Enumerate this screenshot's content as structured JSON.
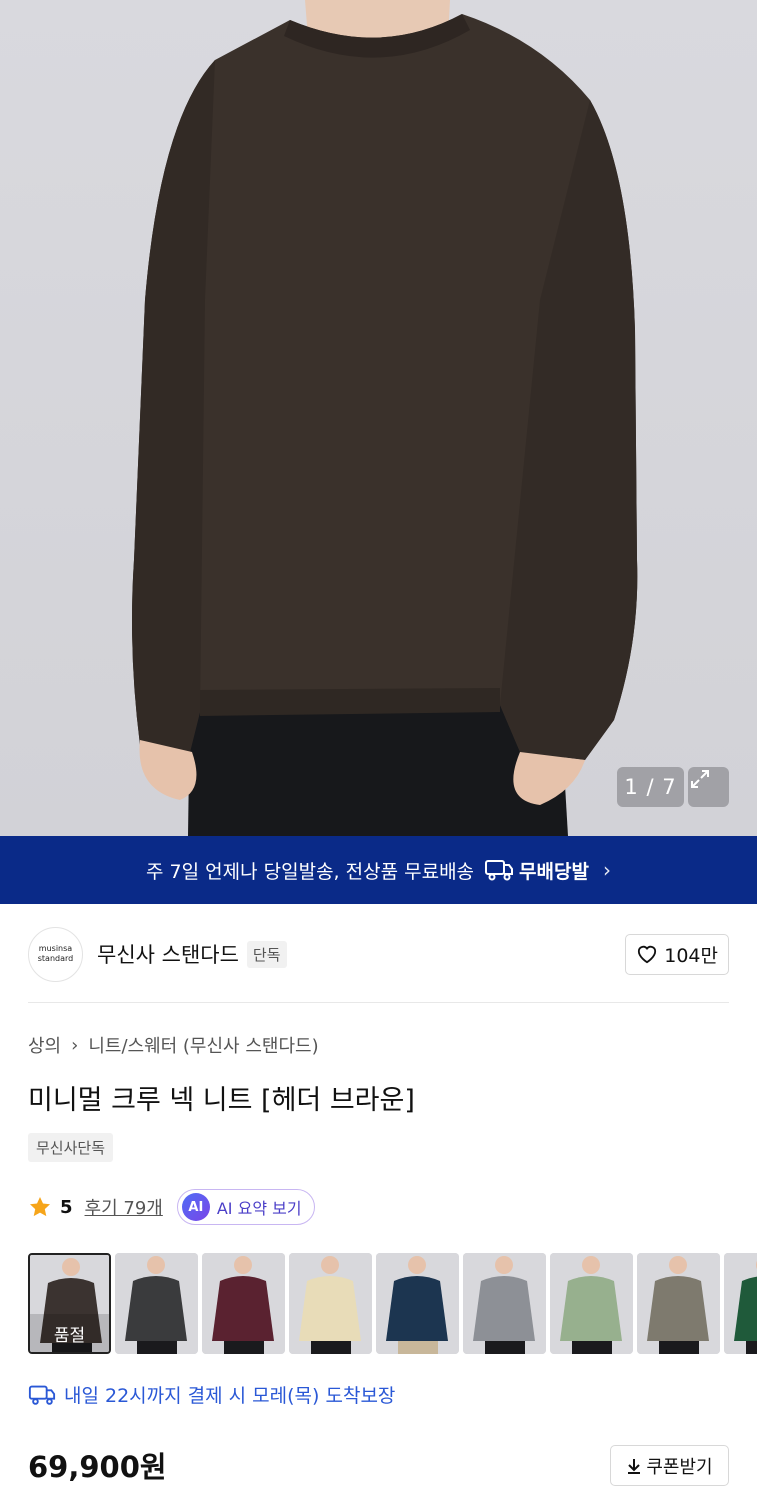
{
  "gallery": {
    "counter": "1 / 7"
  },
  "banner": {
    "text": "주 7일 언제나 당일발송, 전상품 무료배송",
    "badge_label": "무배당발"
  },
  "brand": {
    "logo_line1": "musinsa",
    "logo_line2": "standard",
    "name": "무신사 스탠다드",
    "tag": "단독",
    "likes": "104만"
  },
  "breadcrumb": {
    "level1": "상의",
    "level2": "니트/스웨터 (무신사 스탠다드)"
  },
  "product": {
    "title": "미니멀 크루 넥 니트 [헤더 브라운]",
    "badge": "무신사단독",
    "rating": "5",
    "reviews": "후기 79개",
    "ai_icon": "AI",
    "ai_label": "AI 요약 보기",
    "soldout_label": "품절",
    "price": "69,900원"
  },
  "swatch_colors": [
    "#3b3330",
    "#3a3b3d",
    "#5a2230",
    "#e8dcb8",
    "#1c3550",
    "#8d9096",
    "#97b08e",
    "#7e7a6e",
    "#1f5a3a"
  ],
  "delivery": {
    "text": "내일 22시까지 결제 시 모레(목) 도착보장"
  },
  "coupon": {
    "label": "쿠폰받기"
  }
}
